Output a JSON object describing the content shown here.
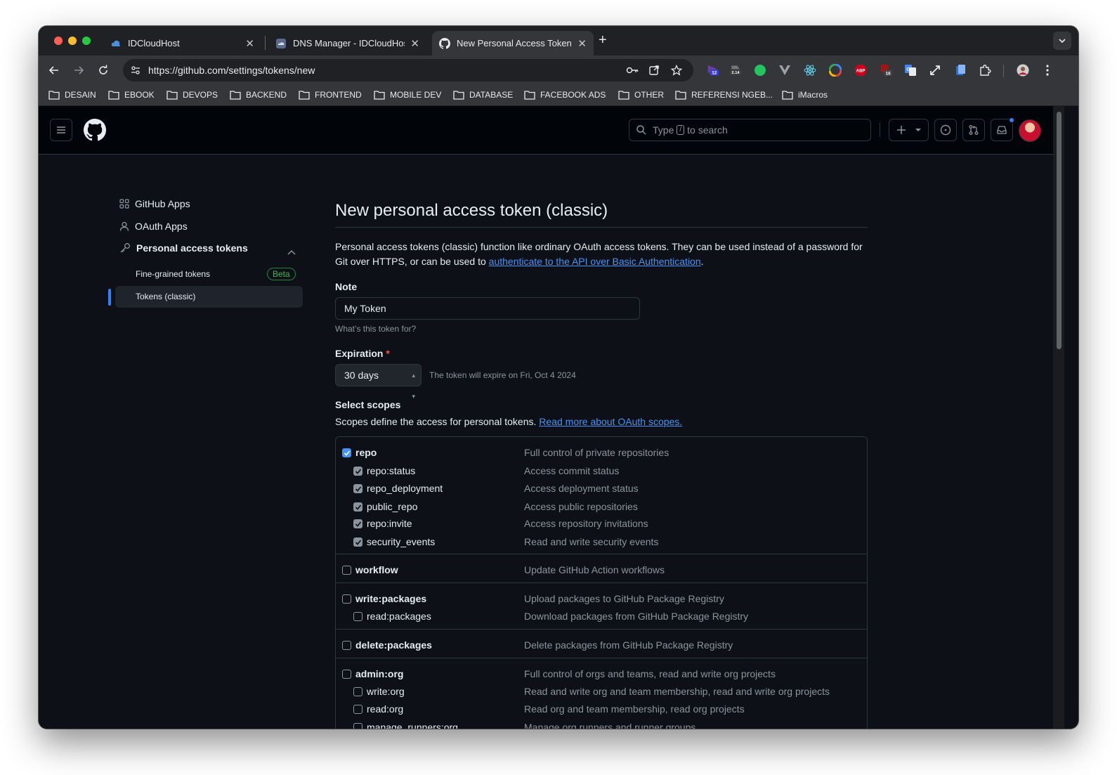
{
  "browser": {
    "tabs": [
      {
        "title": "IDCloudHost",
        "active": false
      },
      {
        "title": "DNS Manager - IDCloudHost",
        "active": false
      },
      {
        "title": "New Personal Access Token (",
        "active": true
      }
    ],
    "url": "https://github.com/settings/tokens/new",
    "extensions": [
      {
        "name": "extension-badge-12-icon",
        "badge": "12"
      },
      {
        "name": "extension-badge-214-icon",
        "badge": "2.14"
      },
      {
        "name": "extension-badge-16-icon",
        "badge": "16"
      },
      {
        "name": "extension-abp-icon",
        "badge": "ABP"
      }
    ],
    "bookmarks": [
      "DESAIN",
      "EBOOK",
      "DEVOPS",
      "BACKEND",
      "FRONTEND",
      "MOBILE DEV",
      "DATABASE",
      "FACEBOOK ADS",
      "OTHER",
      "REFERENSI NGEB...",
      "iMacros"
    ]
  },
  "header": {
    "search_prefix": "Type",
    "search_key": "/",
    "search_suffix": "to search"
  },
  "sidebar": {
    "items": [
      {
        "label": "GitHub Apps"
      },
      {
        "label": "OAuth Apps"
      },
      {
        "label": "Personal access tokens"
      }
    ],
    "subitems": [
      {
        "label": "Fine-grained tokens",
        "badge": "Beta"
      },
      {
        "label": "Tokens (classic)"
      }
    ]
  },
  "main": {
    "title": "New personal access token (classic)",
    "intro_text": "Personal access tokens (classic) function like ordinary OAuth access tokens. They can be used instead of a password for Git over HTTPS, or can be used to",
    "intro_link": "authenticate to the API over Basic Authentication",
    "intro_end": ".",
    "note_label": "Note",
    "note_value": "My Token",
    "note_hint": "What’s this token for?",
    "expiration_label": "Expiration",
    "expiration_required": "*",
    "expiration_value": "30 days",
    "expiration_hint": "The token will expire on Fri, Oct 4 2024",
    "scopes_label": "Select scopes",
    "scopes_desc": "Scopes define the access for personal tokens.",
    "scopes_link": "Read more about OAuth scopes."
  },
  "scopes": [
    {
      "name": "repo",
      "desc": "Full control of private repositories",
      "checked": true
    },
    {
      "name": "repo:status",
      "desc": "Access commit status",
      "checked": true
    },
    {
      "name": "repo_deployment",
      "desc": "Access deployment status",
      "checked": true
    },
    {
      "name": "public_repo",
      "desc": "Access public repositories",
      "checked": true
    },
    {
      "name": "repo:invite",
      "desc": "Access repository invitations",
      "checked": true
    },
    {
      "name": "security_events",
      "desc": "Read and write security events",
      "checked": true
    },
    {
      "name": "workflow",
      "desc": "Update GitHub Action workflows",
      "checked": false
    },
    {
      "name": "write:packages",
      "desc": "Upload packages to GitHub Package Registry",
      "checked": false
    },
    {
      "name": "read:packages",
      "desc": "Download packages from GitHub Package Registry",
      "checked": false
    },
    {
      "name": "delete:packages",
      "desc": "Delete packages from GitHub Package Registry",
      "checked": false
    },
    {
      "name": "admin:org",
      "desc": "Full control of orgs and teams, read and write org projects",
      "checked": false
    },
    {
      "name": "write:org",
      "desc": "Read and write org and team membership, read and write org projects",
      "checked": false
    },
    {
      "name": "read:org",
      "desc": "Read org and team membership, read org projects",
      "checked": false
    },
    {
      "name": "manage_runners:org",
      "desc": "Manage org runners and runner groups",
      "checked": false
    }
  ]
}
